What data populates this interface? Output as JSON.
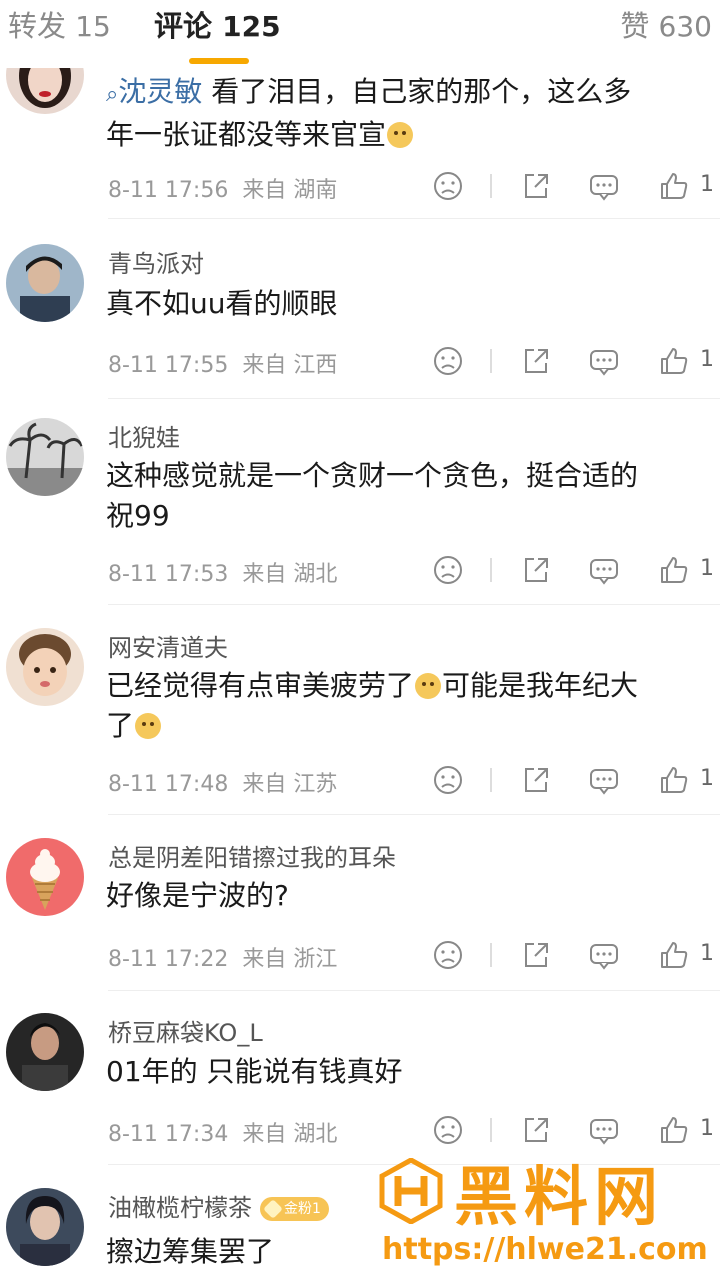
{
  "tabs": {
    "repost": {
      "label": "转发",
      "count": "15"
    },
    "comments": {
      "label": "评论",
      "count": "125"
    },
    "likes": {
      "label": "赞",
      "count": "630"
    }
  },
  "comments": [
    {
      "username": "",
      "mention": "沈灵敏",
      "text_line1": " 看了泪目，自己家的那个，这么多",
      "text_line2": "年一张证都没等来官宣",
      "time": "8-11 17:56",
      "source": "来自 湖南",
      "likes": "1"
    },
    {
      "username": "青鸟派对",
      "text_line1": "真不如uu看的顺眼",
      "time": "8-11 17:55",
      "source": "来自 江西",
      "likes": "1"
    },
    {
      "username": "北猊娃",
      "text_line1": "这种感觉就是一个贪财一个贪色，挺合适的",
      "text_line2": "祝99",
      "time": "8-11 17:53",
      "source": "来自 湖北",
      "likes": "1"
    },
    {
      "username": "网安清道夫",
      "text_line1": "已经觉得有点审美疲劳了",
      "text_line1b": "可能是我年纪大",
      "text_line2": "了",
      "time": "8-11 17:48",
      "source": "来自 江苏",
      "likes": "1"
    },
    {
      "username": "总是阴差阳错擦过我的耳朵",
      "text_line1": "好像是宁波的?",
      "time": "8-11 17:22",
      "source": "来自 浙江",
      "likes": "1"
    },
    {
      "username": "桥豆麻袋KO_L",
      "text_line1": "01年的 只能说有钱真好",
      "time": "8-11 17:34",
      "source": "来自 湖北",
      "likes": "1"
    },
    {
      "username": "油橄榄柠檬茶",
      "badge": "金粉1",
      "text_line1": "擦边筹集罢了"
    }
  ],
  "watermark": {
    "title": "黑料网",
    "url": "https://hlwe21.com"
  },
  "colors": {
    "accent": "#f7a800",
    "link": "#3b6ea5",
    "watermark": "#f59a12",
    "meta_text": "#999999"
  }
}
